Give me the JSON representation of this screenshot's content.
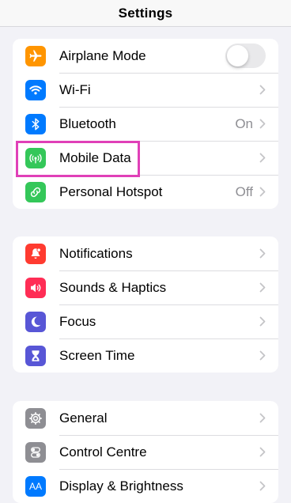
{
  "navbar": {
    "title": "Settings"
  },
  "group1": {
    "airplane": {
      "label": "Airplane Mode",
      "icon": "airplane-icon",
      "color": "#ff9500",
      "toggle_on": false
    },
    "wifi": {
      "label": "Wi-Fi",
      "icon": "wifi-icon",
      "color": "#007aff"
    },
    "bluetooth": {
      "label": "Bluetooth",
      "icon": "bluetooth-icon",
      "color": "#007aff",
      "value": "On"
    },
    "mobile_data": {
      "label": "Mobile Data",
      "icon": "antenna-icon",
      "color": "#34c759"
    },
    "hotspot": {
      "label": "Personal Hotspot",
      "icon": "link-icon",
      "color": "#34c759",
      "value": "Off"
    }
  },
  "group2": {
    "notifications": {
      "label": "Notifications",
      "icon": "notification-bell-icon",
      "color": "#ff3b30"
    },
    "sounds": {
      "label": "Sounds & Haptics",
      "icon": "speaker-icon",
      "color": "#ff2d55"
    },
    "focus": {
      "label": "Focus",
      "icon": "moon-icon",
      "color": "#5856d6"
    },
    "screen_time": {
      "label": "Screen Time",
      "icon": "hourglass-icon",
      "color": "#5856d6"
    }
  },
  "group3": {
    "general": {
      "label": "General",
      "icon": "gear-icon",
      "color": "#8e8e93"
    },
    "control_centre": {
      "label": "Control Centre",
      "icon": "toggles-icon",
      "color": "#8e8e93"
    },
    "display": {
      "label": "Display & Brightness",
      "icon": "text-size-icon",
      "icon_text": "AA",
      "color": "#007aff"
    }
  },
  "highlight": {
    "target": "mobile_data",
    "color": "#e040b8"
  }
}
